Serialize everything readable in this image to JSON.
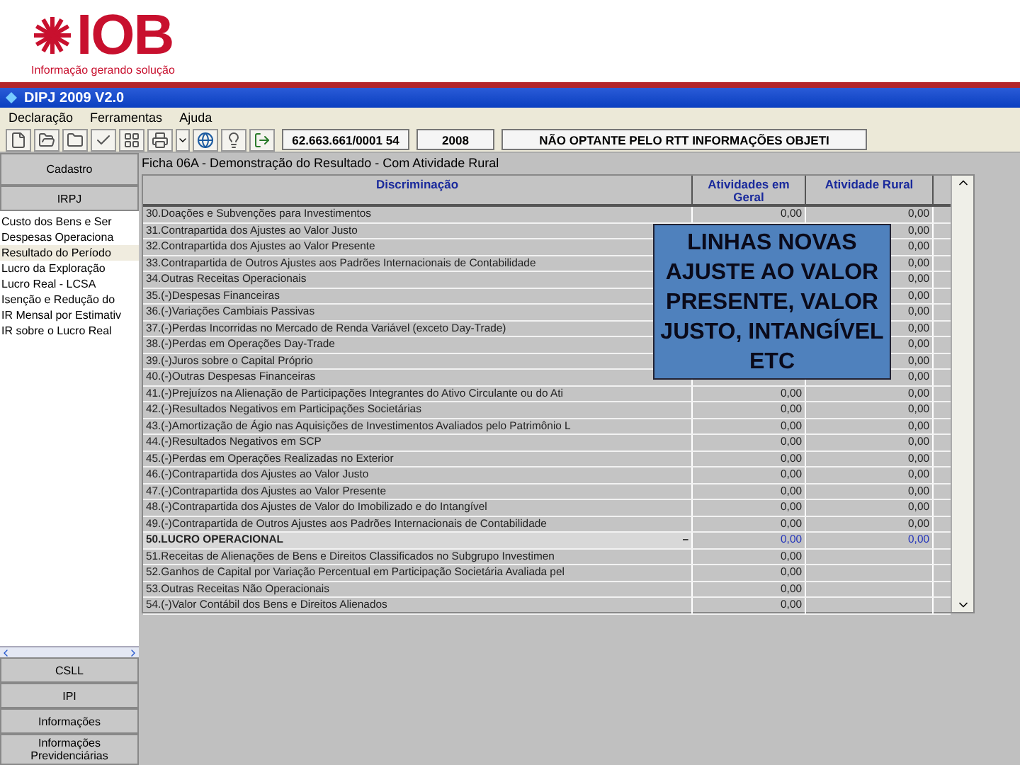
{
  "logo": {
    "name": "IOB",
    "tagline": "Informação gerando solução"
  },
  "window": {
    "title": "DIPJ 2009 V2.0"
  },
  "menu": [
    "Declaração",
    "Ferramentas",
    "Ajuda"
  ],
  "toolbar": {
    "fields": [
      "62.663.661/0001 54",
      "2008",
      "NÃO OPTANTE PELO RTT INFORMAÇÕES OBJETI"
    ]
  },
  "sidebar": {
    "top_buttons": [
      "Cadastro",
      "IRPJ"
    ],
    "items": [
      {
        "label": "Custo dos Bens e Ser",
        "selected": false
      },
      {
        "label": "Despesas Operaciona",
        "selected": false
      },
      {
        "label": "Resultado do Período",
        "selected": true
      },
      {
        "label": "Lucro da Exploração",
        "selected": false
      },
      {
        "label": "Lucro Real - LCSA",
        "selected": false
      },
      {
        "label": "Isenção e Redução do",
        "selected": false
      },
      {
        "label": "IR Mensal por Estimativ",
        "selected": false
      },
      {
        "label": "IR sobre o Lucro Real",
        "selected": false
      }
    ],
    "bottom_buttons": [
      "CSLL",
      "IPI",
      "Informações",
      "Informações Previdenciárias"
    ]
  },
  "form": {
    "title": "Ficha 06A - Demonstração do Resultado - Com Atividade Rural",
    "columns": [
      "Discriminação",
      "Atividades em Geral",
      "Atividade Rural"
    ],
    "rows": [
      {
        "label": "30.Doações e Subvenções para Investimentos",
        "total": false,
        "general": "0,00",
        "rural": "0,00"
      },
      {
        "label": "31.Contrapartida dos Ajustes ao Valor Justo",
        "total": false,
        "rural": "0,00"
      },
      {
        "label": "32.Contrapartida dos Ajustes ao Valor Presente",
        "total": false,
        "rural": "0,00"
      },
      {
        "label": "33.Contrapartida de Outros Ajustes aos Padrões Internacionais de Contabilidade",
        "total": false,
        "rural": "0,00"
      },
      {
        "label": "34.Outras Receitas Operacionais",
        "total": false,
        "rural": "0,00"
      },
      {
        "label": "35.(-)Despesas Financeiras",
        "total": false,
        "rural": "0,00"
      },
      {
        "label": "36.(-)Variações Cambiais Passivas",
        "total": false,
        "rural": "0,00"
      },
      {
        "label": "37.(-)Perdas Incorridas no Mercado de Renda Variável (exceto Day-Trade)",
        "total": false,
        "rural": "0,00"
      },
      {
        "label": "38.(-)Perdas em Operações Day-Trade",
        "total": false,
        "rural": "0,00"
      },
      {
        "label": "39.(-)Juros sobre o Capital Próprio",
        "total": false,
        "rural": "0,00"
      },
      {
        "label": "40.(-)Outras Despesas Financeiras",
        "total": false,
        "rural": "0,00"
      },
      {
        "label": "41.(-)Prejuízos na Alienação de Participações Integrantes do Ativo Circulante ou do Ati",
        "total": false,
        "general": "0,00",
        "rural": "0,00"
      },
      {
        "label": "42.(-)Resultados Negativos em Participações Societárias",
        "total": false,
        "general": "0,00",
        "rural": "0,00"
      },
      {
        "label": "43.(-)Amortização de Ágio nas Aquisições de Investimentos Avaliados pelo Patrimônio L",
        "total": false,
        "general": "0,00",
        "rural": "0,00"
      },
      {
        "label": "44.(-)Resultados Negativos em SCP",
        "total": false,
        "general": "0,00",
        "rural": "0,00"
      },
      {
        "label": "45.(-)Perdas em Operações Realizadas no Exterior",
        "total": false,
        "general": "0,00",
        "rural": "0,00"
      },
      {
        "label": "46.(-)Contrapartida dos Ajustes ao Valor Justo",
        "total": false,
        "general": "0,00",
        "rural": "0,00"
      },
      {
        "label": "47.(-)Contrapartida dos Ajustes ao Valor Presente",
        "total": false,
        "general": "0,00",
        "rural": "0,00"
      },
      {
        "label": "48.(-)Contrapartida dos Ajustes de Valor do Imobilizado e do Intangível",
        "total": false,
        "general": "0,00",
        "rural": "0,00"
      },
      {
        "label": "49.(-)Contrapartida de Outros Ajustes aos Padrões Internacionais de Contabilidade",
        "total": false,
        "general": "0,00",
        "rural": "0,00"
      },
      {
        "label": "50.LUCRO OPERACIONAL",
        "total": true,
        "marker": "–",
        "general": "0,00",
        "rural": "0,00"
      },
      {
        "label": "51.Receitas de Alienações de Bens e Direitos Classificados no Subgrupo Investimen",
        "total": false,
        "general": "0,00"
      },
      {
        "label": "52.Ganhos de Capital por Variação Percentual em Participação Societária Avaliada pel",
        "total": false,
        "general": "0,00"
      },
      {
        "label": "53.Outras Receitas Não Operacionais",
        "total": false,
        "general": "0,00"
      },
      {
        "label": "54.(-)Valor Contábil dos Bens e Direitos Alienados",
        "total": false,
        "general": "0,00"
      }
    ]
  },
  "callout": "LINHAS NOVAS AJUSTE AO VALOR PRESENTE, VALOR JUSTO, INTANGÍVEL ETC"
}
